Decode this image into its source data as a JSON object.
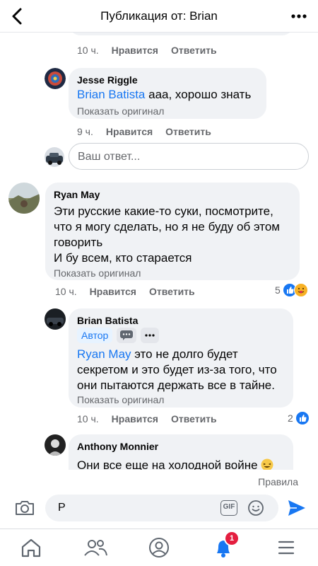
{
  "header": {
    "title": "Публикация от: Brian"
  },
  "comments": {
    "c0": {
      "time": "10 ч.",
      "like": "Нравится",
      "reply": "Ответить"
    },
    "c1": {
      "author": "Jesse Riggle",
      "mention": "Brian Batista",
      "text": " ааа, хорошо знать",
      "show_original": "Показать оригинал",
      "time": "9 ч.",
      "like": "Нравится",
      "reply": "Ответить"
    },
    "reply_input": {
      "placeholder": "Ваш ответ..."
    },
    "c2": {
      "author": "Ryan May",
      "lines": [
        "Эти русские какие-то суки, посмотрите,",
        "что я могу сделать, но я не буду об этом",
        "говорить",
        "И бу всем, кто старается"
      ],
      "show_original": "Показать оригинал",
      "time": "10 ч.",
      "like": "Нравится",
      "reply": "Ответить",
      "reaction_count": "5"
    },
    "c3": {
      "author": "Brian Batista",
      "badge": "Автор",
      "mention": "Ryan May",
      "line1": " это не долго будет",
      "line2": "секретом и это будет из-за того, что",
      "line3": "они пытаются держать все в тайне.",
      "show_original": "Показать оригинал",
      "time": "10 ч.",
      "like": "Нравится",
      "reply": "Ответить",
      "reaction_count": "2"
    },
    "c4": {
      "author": "Anthony Monnier",
      "text": "Они все еще на холодной войне"
    }
  },
  "rules_link": "Правила",
  "composer": {
    "value": "Р",
    "gif": "GIF"
  },
  "tabbar": {
    "notification_count": "1"
  },
  "colors": {
    "accent": "#1877f2",
    "bubble": "#f0f2f5",
    "secondary": "#65676b",
    "badge": "#e41e3f"
  }
}
